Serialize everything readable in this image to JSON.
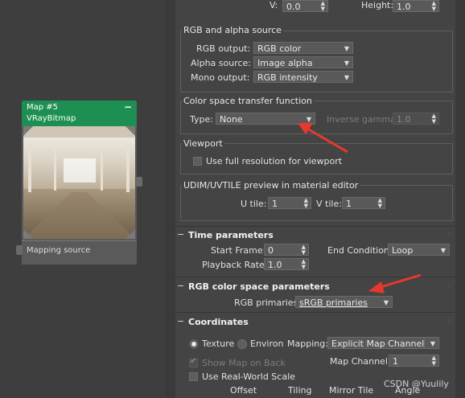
{
  "node": {
    "title": "Map #5",
    "subtitle": "VRayBitmap",
    "minimize_symbol": "−",
    "footer": "Mapping source",
    "colors": {
      "header": "#1d8f52"
    }
  },
  "top_row": {
    "v_label": "V:",
    "v_value": "0.0",
    "height_label": "Height:",
    "height_value": "1.0"
  },
  "rgb_alpha": {
    "title": "RGB and alpha source",
    "rgb_output_label": "RGB output:",
    "rgb_output_value": "RGB color",
    "alpha_source_label": "Alpha source:",
    "alpha_source_value": "Image alpha",
    "mono_output_label": "Mono output:",
    "mono_output_value": "RGB intensity"
  },
  "color_space": {
    "title": "Color space transfer function",
    "type_label": "Type:",
    "type_value": "None",
    "inverse_gamma_label": "Inverse gamma:",
    "inverse_gamma_value": "1.0"
  },
  "viewport": {
    "title": "Viewport",
    "full_res_label": "Use full resolution for viewport"
  },
  "udim": {
    "title": "UDIM/UVTILE preview in material editor",
    "u_tile_label": "U tile:",
    "u_tile_value": "1",
    "v_tile_label": "V tile:",
    "v_tile_value": "1"
  },
  "time": {
    "title": "Time parameters",
    "toggle": "−",
    "start_frame_label": "Start Frame:",
    "start_frame_value": "0",
    "end_condition_label": "End Condition:",
    "end_condition_value": "Loop",
    "playback_rate_label": "Playback Rate:",
    "playback_rate_value": "1.0"
  },
  "rgb_primaries": {
    "title": "RGB color space parameters",
    "toggle": "−",
    "label": "RGB primaries:",
    "value": "sRGB primaries"
  },
  "coordinates": {
    "title": "Coordinates",
    "toggle": "−",
    "texture_label": "Texture",
    "environ_label": "Environ",
    "mapping_label": "Mapping:",
    "mapping_value": "Explicit Map Channel",
    "show_map_label": "Show Map on Back",
    "map_channel_label": "Map Channel:",
    "map_channel_value": "1",
    "real_world_label": "Use Real-World Scale",
    "col_offset": "Offset",
    "col_tiling": "Tiling",
    "col_mirror_tile": "Mirror Tile",
    "col_angle": "Angle"
  },
  "watermark": "CSDN @Yuulily",
  "annotation_color": "#e8382d"
}
